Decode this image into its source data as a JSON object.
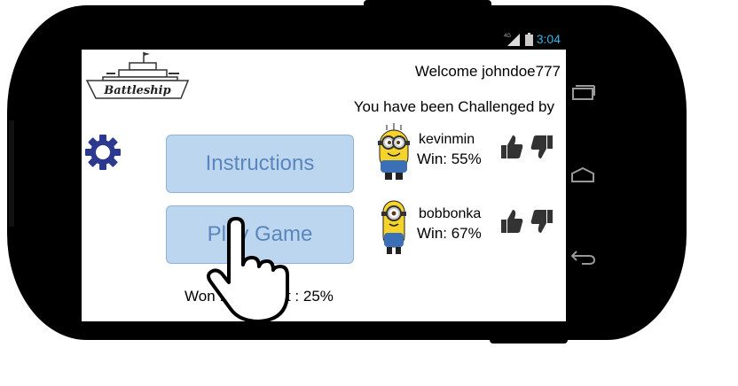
{
  "status_bar": {
    "network": "4G",
    "time": "3:04"
  },
  "app": {
    "logo_text": "Battleship"
  },
  "header": {
    "welcome": "Welcome johndoe777",
    "challenge_heading": "You have been Challenged by"
  },
  "menu": {
    "instructions_label": "Instructions",
    "play_label": "Play Game"
  },
  "stats": {
    "summary": "Won : 75% Lost : 25%"
  },
  "challengers": [
    {
      "name": "kevinmin",
      "win_rate": "Win: 55%"
    },
    {
      "name": "bobbonka",
      "win_rate": "Win: 67%"
    }
  ],
  "icons": {
    "settings": "gear-icon",
    "accept": "thumbs-up-icon",
    "decline": "thumbs-down-icon",
    "gesture": "pointing-hand-icon"
  },
  "colors": {
    "button_fill": "#bcd6f0",
    "button_text": "#5b86bd",
    "gear": "#2b3a8f",
    "clock": "#33b5e5"
  }
}
